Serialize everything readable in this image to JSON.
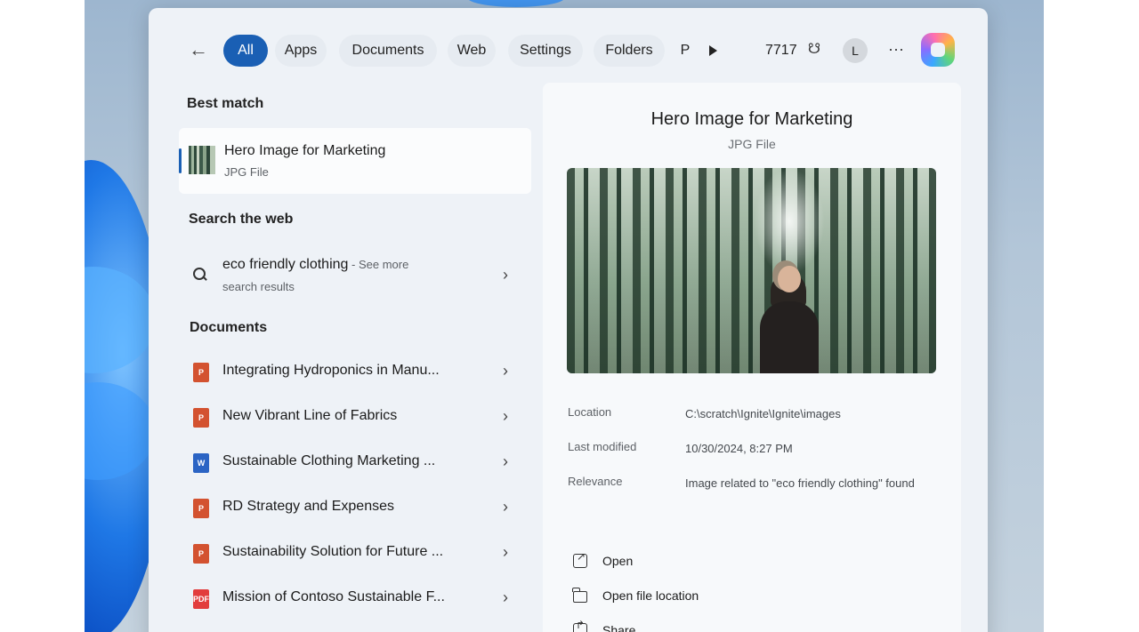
{
  "filters": {
    "all": "All",
    "apps": "Apps",
    "documents": "Documents",
    "web": "Web",
    "settings": "Settings",
    "folders": "Folders",
    "partial": "P"
  },
  "header": {
    "points": "7717",
    "avatar_initial": "L",
    "more": "···"
  },
  "sections": {
    "best_match": "Best match",
    "search_web": "Search the web",
    "documents": "Documents"
  },
  "best_match": {
    "name": "Hero Image for Marketing",
    "type": "JPG File"
  },
  "web_result": {
    "query": "eco friendly clothing",
    "suffix": " - See more",
    "suffix2": "search results"
  },
  "documents": [
    {
      "label": "Integrating Hydroponics in Manu...",
      "icon": "ppt-file-icon"
    },
    {
      "label": "New Vibrant Line of Fabrics",
      "icon": "ppt-file-icon"
    },
    {
      "label": "Sustainable Clothing Marketing ...",
      "icon": "word-file-icon"
    },
    {
      "label": "RD Strategy and Expenses",
      "icon": "ppt-file-icon"
    },
    {
      "label": "Sustainability Solution for Future ...",
      "icon": "ppt-file-icon"
    },
    {
      "label": "Mission of Contoso Sustainable F...",
      "icon": "pdf-file-icon"
    }
  ],
  "preview": {
    "title": "Hero Image for Marketing",
    "subtitle": "JPG File",
    "location_label": "Location",
    "location_value": "C:\\scratch\\Ignite\\Ignite\\images",
    "modified_label": "Last modified",
    "modified_value": "10/30/2024, 8:27 PM",
    "relevance_label": "Relevance",
    "relevance_value": "Image related to \"eco friendly clothing\" found",
    "actions": {
      "open": "Open",
      "open_location": "Open file location",
      "share": "Share"
    }
  },
  "icons": {
    "chevron": "›",
    "back": "←",
    "trophy": "☋"
  },
  "colors": {
    "accent": "#1a5fb4",
    "panel": "#eef2f7"
  }
}
